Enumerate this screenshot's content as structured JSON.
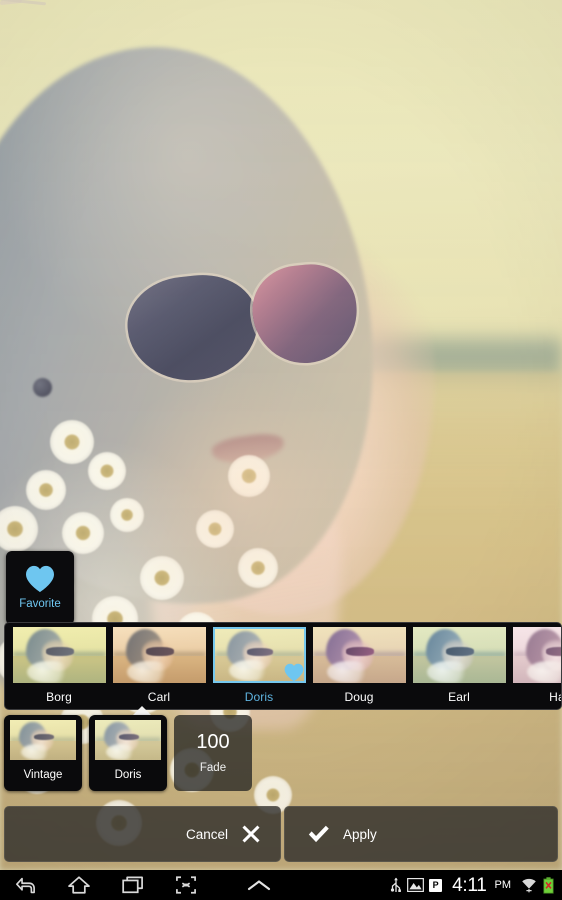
{
  "app": {
    "screen": "photo-filter-editor"
  },
  "favorite": {
    "label": "Favorite",
    "icon": "heart-icon",
    "color": "#6ec6f0"
  },
  "filter_strip": {
    "selected": "Doris",
    "items": [
      {
        "label": "Borg",
        "selected": false,
        "favorited": false
      },
      {
        "label": "Carl",
        "selected": false,
        "favorited": false
      },
      {
        "label": "Doris",
        "selected": true,
        "favorited": true
      },
      {
        "label": "Doug",
        "selected": false,
        "favorited": false
      },
      {
        "label": "Earl",
        "selected": false,
        "favorited": false
      },
      {
        "label": "Har",
        "selected": false,
        "favorited": false
      }
    ]
  },
  "sub_row": {
    "presets": [
      {
        "label": "Vintage"
      },
      {
        "label": "Doris"
      }
    ],
    "fade": {
      "value": "100",
      "label": "Fade"
    }
  },
  "actions": {
    "cancel_label": "Cancel",
    "cancel_icon": "close-icon",
    "apply_label": "Apply",
    "apply_icon": "check-icon"
  },
  "navbar": {
    "back_icon": "back-arrow-icon",
    "home_icon": "home-icon",
    "recents_icon": "recent-apps-icon",
    "screenshot_icon": "screen-capture-icon",
    "expand_icon": "chevron-up-icon",
    "status": {
      "usb_icon": "usb-icon",
      "image_icon": "image-icon",
      "p_badge": "P",
      "time": "4:11",
      "ampm": "PM",
      "wifi_icon": "wifi-icon",
      "battery_icon": "battery-error-icon"
    }
  },
  "theme": {
    "accent": "#6ec6f0",
    "panel": "#0a0a0c",
    "selected_border": "#76c8ee",
    "selected_label": "#5fb4e0"
  }
}
